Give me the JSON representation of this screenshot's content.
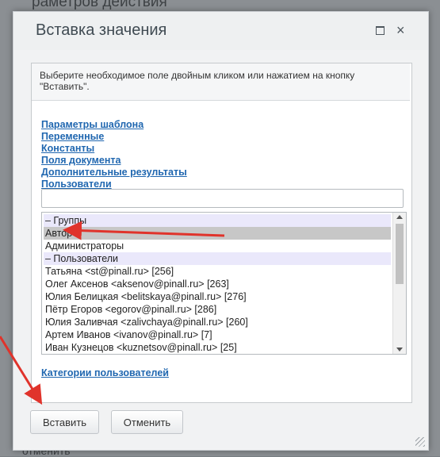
{
  "background": {
    "top_text": "раметров действия",
    "bottom_text": "отменить"
  },
  "dialog": {
    "title": "Вставка значения",
    "hint": "Выберите необходимое поле двойным кликом или нажатием на кнопку \"Вставить\".",
    "links": [
      "Параметры шаблона",
      "Переменные",
      "Константы",
      "Поля документа",
      "Дополнительные результаты",
      "Пользователи"
    ],
    "search_value": "",
    "list_options": [
      {
        "label": "– Группы",
        "kind": "group"
      },
      {
        "label": "Автор",
        "kind": "selected"
      },
      {
        "label": "Администраторы",
        "kind": "item"
      },
      {
        "label": "– Пользователи",
        "kind": "group"
      },
      {
        "label": "Татьяна <st@pinall.ru> [256]",
        "kind": "item"
      },
      {
        "label": "Олег Аксенов <aksenov@pinall.ru> [263]",
        "kind": "item"
      },
      {
        "label": "Юлия Белицкая <belitskaya@pinall.ru> [276]",
        "kind": "item"
      },
      {
        "label": "Пётр Егоров <egorov@pinall.ru> [286]",
        "kind": "item"
      },
      {
        "label": "Юлия Заливчая <zalivchaya@pinall.ru> [260]",
        "kind": "item"
      },
      {
        "label": "Артем Иванов <ivanov@pinall.ru> [7]",
        "kind": "item"
      },
      {
        "label": "Иван Кузнецов <kuznetsov@pinall.ru> [25]",
        "kind": "item"
      }
    ],
    "category_link": "Категории пользователей",
    "buttons": {
      "insert": "Вставить",
      "cancel": "Отменить"
    },
    "icons": {
      "maximize": "maximize-icon",
      "close": "close-icon",
      "close_glyph": "×"
    }
  },
  "annotation_color": "#e0332b"
}
